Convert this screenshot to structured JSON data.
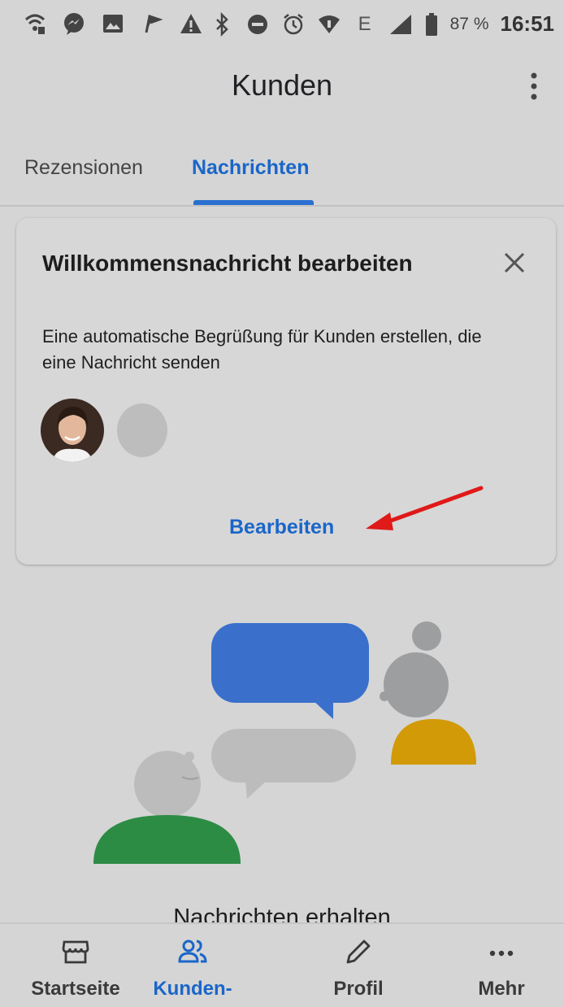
{
  "status_bar": {
    "icons_left": [
      "wifi-icon",
      "messenger-icon",
      "image-icon",
      "flag-icon",
      "warning-icon"
    ],
    "icons_right": [
      "bluetooth-icon",
      "do-not-disturb-icon",
      "alarm-icon",
      "wifi-signal-icon",
      "network-e-icon",
      "cell-signal-icon",
      "battery-icon"
    ],
    "network_type": "E",
    "battery_percent": "87 %",
    "time": "16:51"
  },
  "app_bar": {
    "title": "Kunden",
    "menu_icon": "more-vert-icon"
  },
  "tabs": [
    {
      "label": "Rezensionen",
      "active": false
    },
    {
      "label": "Nachrichten",
      "active": true
    }
  ],
  "card": {
    "title": "Willkommensnachricht bearbeiten",
    "close_icon": "close-icon",
    "body": "Eine automatische Begrüßung für Kunden erstellen, die eine Nachricht senden",
    "edit_label": "Bearbeiten"
  },
  "section_heading": "Nachrichten erhalten",
  "bottom_nav": [
    {
      "label": "Startseite",
      "icon": "storefront-icon",
      "active": false
    },
    {
      "label": "Kunden-",
      "icon": "customers-icon",
      "active": true
    },
    {
      "label": "Profil",
      "icon": "pencil-icon",
      "active": false
    },
    {
      "label": "Mehr",
      "icon": "more-horiz-icon",
      "active": false
    }
  ],
  "colors": {
    "accent": "#1a66c9",
    "background": "#d5d5d5",
    "bubble_blue": "#3a70cc",
    "person_green": "#2c8c44",
    "person_yellow": "#d19a06"
  }
}
